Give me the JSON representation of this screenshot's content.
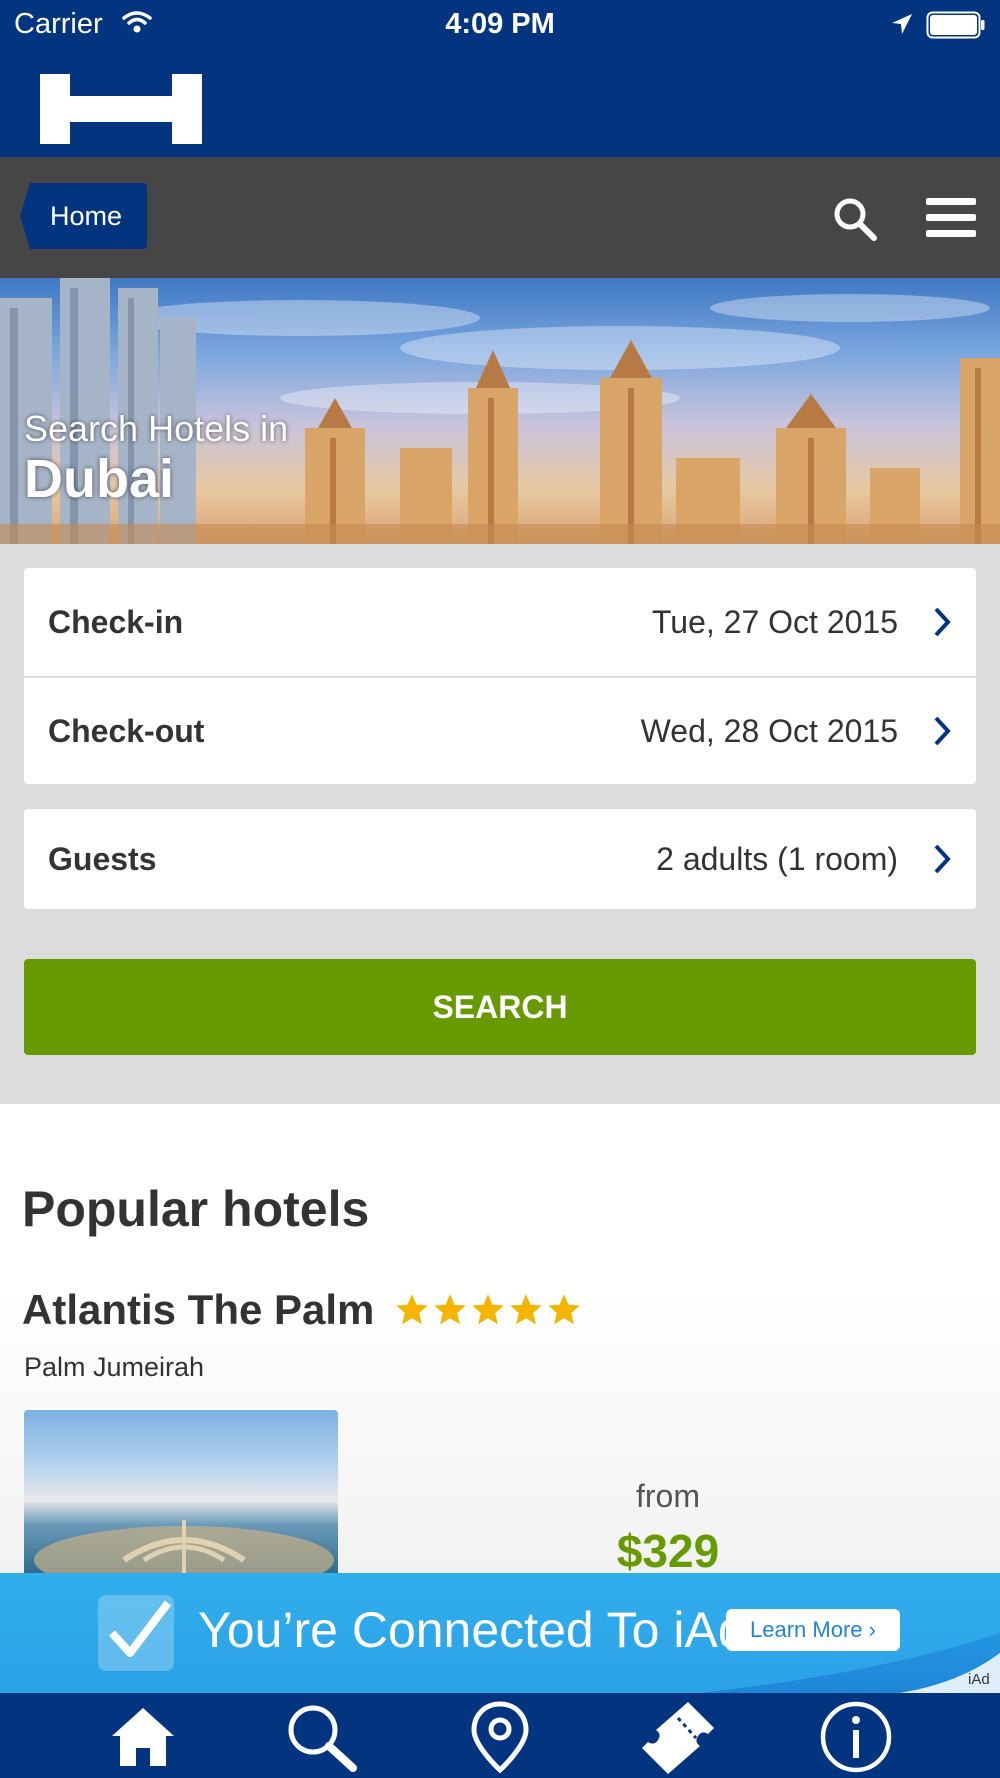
{
  "status_bar": {
    "carrier": "Carrier",
    "time": "4:09 PM"
  },
  "nav": {
    "home_label": "Home"
  },
  "hero": {
    "subtitle": "Search Hotels in",
    "city": "Dubai"
  },
  "search_form": {
    "checkin": {
      "label": "Check-in",
      "value": "Tue, 27 Oct 2015"
    },
    "checkout": {
      "label": "Check-out",
      "value": "Wed, 28 Oct 2015"
    },
    "guests": {
      "label": "Guests",
      "value": "2 adults (1 room)"
    },
    "search_label": "SEARCH"
  },
  "popular": {
    "heading": "Popular hotels",
    "hotels": [
      {
        "name": "Atlantis The Palm",
        "stars": 5,
        "area": "Palm Jumeirah",
        "price_prefix": "from",
        "price": "$329"
      }
    ]
  },
  "ad": {
    "message": "You’re Connected To iAd",
    "learn_more": "Learn More ›",
    "tag": "iAd"
  },
  "tabs": [
    {
      "icon": "home-icon"
    },
    {
      "icon": "search-icon"
    },
    {
      "icon": "map-pin-icon"
    },
    {
      "icon": "ticket-icon"
    },
    {
      "icon": "info-icon"
    }
  ],
  "colors": {
    "brand_blue": "#03347f",
    "nav_gray": "#464646",
    "accent_green": "#669a00",
    "star_yellow": "#f5b400",
    "ad_blue": "#1e86d8"
  }
}
